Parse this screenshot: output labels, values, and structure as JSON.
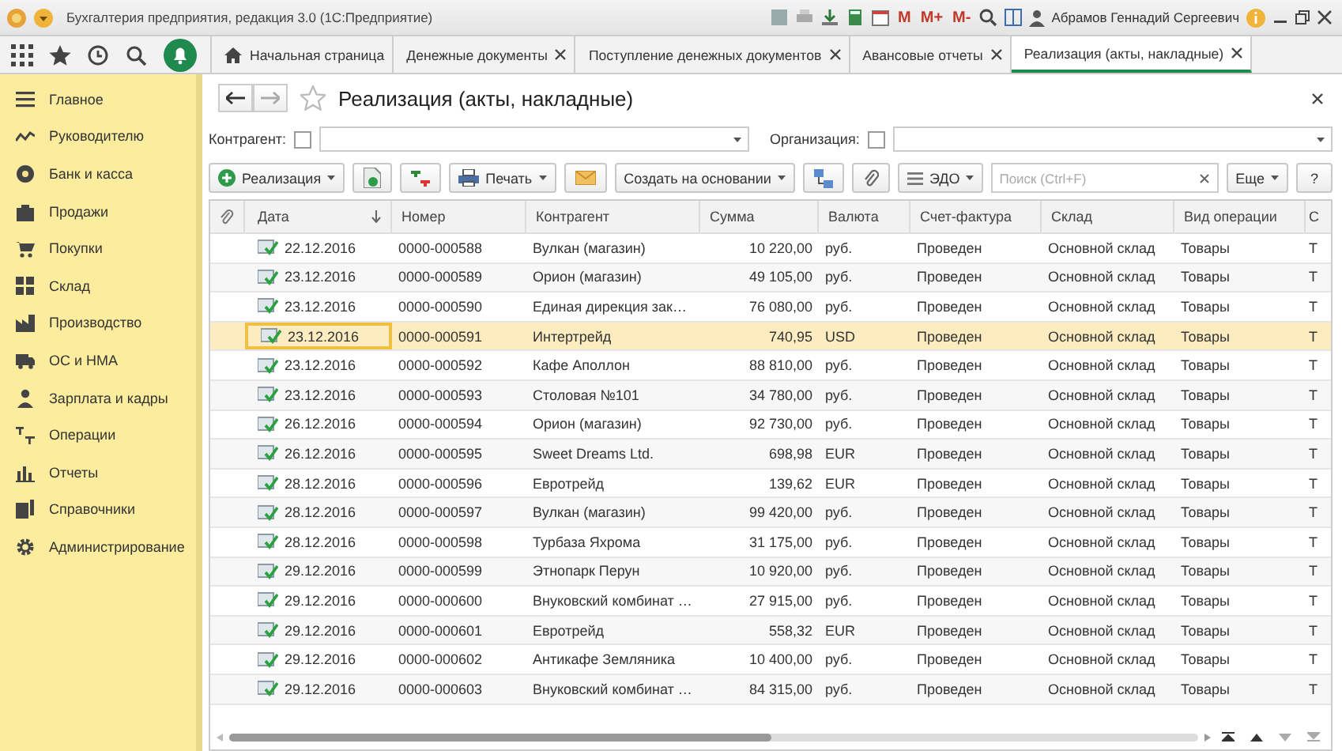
{
  "window": {
    "title": "Бухгалтерия предприятия, редакция 3.0  (1С:Предприятие)",
    "quick_buttons": [
      "M",
      "M+",
      "M-"
    ],
    "user": "Абрамов Геннадий Сергеевич"
  },
  "tabs": [
    {
      "label": "Начальная страница",
      "closable": false,
      "selected": false
    },
    {
      "label": "Денежные документы",
      "closable": true,
      "selected": false
    },
    {
      "label": "Поступление денежных документов",
      "closable": true,
      "selected": false
    },
    {
      "label": "Авансовые отчеты",
      "closable": true,
      "selected": false
    },
    {
      "label": "Реализация (акты, накладные)",
      "closable": true,
      "selected": true
    }
  ],
  "sidebar": {
    "items": [
      {
        "label": "Главное"
      },
      {
        "label": "Руководителю"
      },
      {
        "label": "Банк и касса"
      },
      {
        "label": "Продажи"
      },
      {
        "label": "Покупки"
      },
      {
        "label": "Склад"
      },
      {
        "label": "Производство"
      },
      {
        "label": "ОС и НМА"
      },
      {
        "label": "Зарплата и кадры"
      },
      {
        "label": "Операции"
      },
      {
        "label": "Отчеты"
      },
      {
        "label": "Справочники"
      },
      {
        "label": "Администрирование"
      }
    ]
  },
  "form": {
    "title": "Реализация (акты, накладные)",
    "filters": [
      {
        "label": "Контрагент:",
        "checked": false
      },
      {
        "label": "Организация:",
        "checked": false
      }
    ],
    "toolbar": {
      "create": "Реализация",
      "print": "Печать",
      "based_on": "Создать на основании",
      "edo": "ЭДО",
      "search_placeholder": "Поиск (Ctrl+F)",
      "more": "Еще",
      "help": "?"
    }
  },
  "table": {
    "columns": [
      "Дата",
      "Номер",
      "Контрагент",
      "Сумма",
      "Валюта",
      "Счет-фактура",
      "Склад",
      "Вид операции",
      "С"
    ],
    "rows": [
      {
        "cells": [
          "22.12.2016",
          "0000-000588",
          "Вулкан (магазин)",
          "10 220,00",
          "руб.",
          "Проведен",
          "Основной склад",
          "Товары",
          "Т"
        ],
        "selected": false
      },
      {
        "cells": [
          "23.12.2016",
          "0000-000589",
          "Орион (магазин)",
          "49 105,00",
          "руб.",
          "Проведен",
          "Основной склад",
          "Товары",
          "Т"
        ],
        "selected": false
      },
      {
        "cells": [
          "23.12.2016",
          "0000-000590",
          "Единая дирекция зак…",
          "76 080,00",
          "руб.",
          "Проведен",
          "Основной склад",
          "Товары",
          "Т"
        ],
        "selected": false
      },
      {
        "cells": [
          "23.12.2016",
          "0000-000591",
          "Интертрейд",
          "740,95",
          "USD",
          "Проведен",
          "Основной склад",
          "Товары",
          "Т"
        ],
        "selected": true
      },
      {
        "cells": [
          "23.12.2016",
          "0000-000592",
          "Кафе Аполлон",
          "88 810,00",
          "руб.",
          "Проведен",
          "Основной склад",
          "Товары",
          "Т"
        ],
        "selected": false
      },
      {
        "cells": [
          "23.12.2016",
          "0000-000593",
          "Столовая №101",
          "34 780,00",
          "руб.",
          "Проведен",
          "Основной склад",
          "Товары",
          "Т"
        ],
        "selected": false
      },
      {
        "cells": [
          "26.12.2016",
          "0000-000594",
          "Орион (магазин)",
          "92 730,00",
          "руб.",
          "Проведен",
          "Основной склад",
          "Товары",
          "Т"
        ],
        "selected": false
      },
      {
        "cells": [
          "26.12.2016",
          "0000-000595",
          "Sweet Dreams Ltd.",
          "698,98",
          "EUR",
          "Проведен",
          "Основной склад",
          "Товары",
          "Т"
        ],
        "selected": false
      },
      {
        "cells": [
          "28.12.2016",
          "0000-000596",
          "Евротрейд",
          "139,62",
          "EUR",
          "Проведен",
          "Основной склад",
          "Товары",
          "Т"
        ],
        "selected": false
      },
      {
        "cells": [
          "28.12.2016",
          "0000-000597",
          "Вулкан (магазин)",
          "99 420,00",
          "руб.",
          "Проведен",
          "Основной склад",
          "Товары",
          "Т"
        ],
        "selected": false
      },
      {
        "cells": [
          "28.12.2016",
          "0000-000598",
          "Турбаза Яхрома",
          "31 175,00",
          "руб.",
          "Проведен",
          "Основной склад",
          "Товары",
          "Т"
        ],
        "selected": false
      },
      {
        "cells": [
          "29.12.2016",
          "0000-000599",
          "Этнопарк Перун",
          "10 920,00",
          "руб.",
          "Проведен",
          "Основной склад",
          "Товары",
          "Т"
        ],
        "selected": false
      },
      {
        "cells": [
          "29.12.2016",
          "0000-000600",
          "Внуковский комбинат …",
          "27 915,00",
          "руб.",
          "Проведен",
          "Основной склад",
          "Товары",
          "Т"
        ],
        "selected": false
      },
      {
        "cells": [
          "29.12.2016",
          "0000-000601",
          "Евротрейд",
          "558,32",
          "EUR",
          "Проведен",
          "Основной склад",
          "Товары",
          "Т"
        ],
        "selected": false
      },
      {
        "cells": [
          "29.12.2016",
          "0000-000602",
          "Антикафе Земляника",
          "10 400,00",
          "руб.",
          "Проведен",
          "Основной склад",
          "Товары",
          "Т"
        ],
        "selected": false
      },
      {
        "cells": [
          "29.12.2016",
          "0000-000603",
          "Внуковский комбинат …",
          "84 315,00",
          "руб.",
          "Проведен",
          "Основной склад",
          "Товары",
          "Т"
        ],
        "selected": false
      }
    ]
  }
}
